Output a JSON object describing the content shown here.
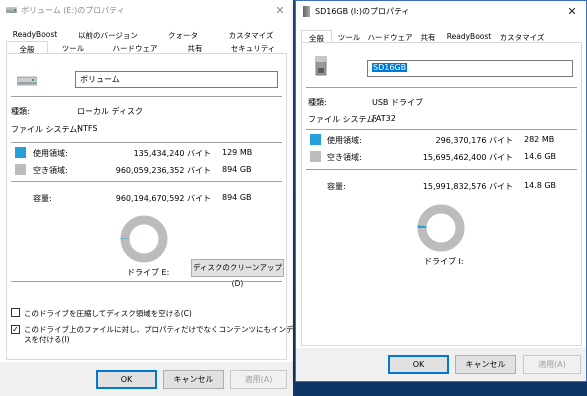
{
  "win1": {
    "title": "ボリューム (E:)のプロパティ",
    "tabs_row1": [
      "ReadyBoost",
      "以前のバージョン",
      "クォータ",
      "カスタマイズ"
    ],
    "tabs_row2": [
      "全般",
      "ツール",
      "ハードウェア",
      "共有",
      "セキュリティ"
    ],
    "selected_tab": "全般",
    "name_value": "ボリューム",
    "type_label": "種類:",
    "type_value": "ローカル ディスク",
    "fs_label": "ファイル システム:",
    "fs_value": "NTFS",
    "used_label": "使用領域:",
    "used_bytes": "135,434,240 バイト",
    "used_size": "129 MB",
    "free_label": "空き領域:",
    "free_bytes": "960,059,236,352 バイト",
    "free_size": "894 GB",
    "cap_label": "容量:",
    "cap_bytes": "960,194,670,592 バイト",
    "cap_size": "894 GB",
    "used_fraction": 0.000141,
    "drive_label": "ドライブ E:",
    "cleanup_button": "ディスクのクリーンアップ(D)",
    "compress_label": "このドライブを圧縮してディスク領域を空ける(C)",
    "compress_checked": false,
    "index_label_line1": "このドライブ上のファイルに対し、プロパティだけでなくコンテンツにもインデック",
    "index_label_line2": "スを付ける(I)",
    "index_checked": true,
    "ok": "OK",
    "cancel": "キャンセル",
    "apply": "適用(A)"
  },
  "win2": {
    "title": "SD16GB (I:)のプロパティ",
    "tabs": [
      "全般",
      "ツール",
      "ハードウェア",
      "共有",
      "ReadyBoost",
      "カスタマイズ"
    ],
    "selected_tab": "全般",
    "name_value": "SD16GB",
    "type_label": "種類:",
    "type_value": "USB ドライブ",
    "fs_label": "ファイル システム:",
    "fs_value": "FAT32",
    "used_label": "使用領域:",
    "used_bytes": "296,370,176 バイト",
    "used_size": "282 MB",
    "free_label": "空き領域:",
    "free_bytes": "15,695,462,400 バイト",
    "free_size": "14.6 GB",
    "cap_label": "容量:",
    "cap_bytes": "15,991,832,576 バイト",
    "cap_size": "14.8 GB",
    "used_fraction": 0.0185,
    "drive_label": "ドライブ I:",
    "ok": "OK",
    "cancel": "キャンセル",
    "apply": "適用(A)"
  },
  "colors": {
    "used": "#26a0da",
    "free": "#bcbcbc",
    "accent": "#0078d7",
    "title_active": "#000000",
    "title_inactive": "#8a8a8a"
  }
}
